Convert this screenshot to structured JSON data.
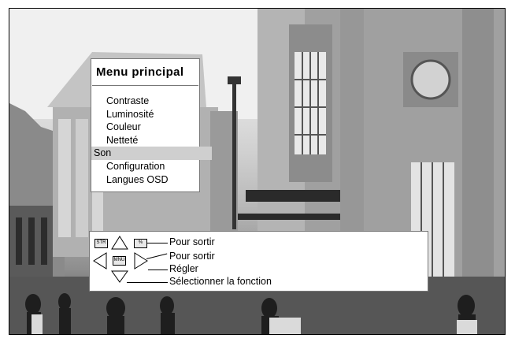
{
  "menu": {
    "title": "Menu principal",
    "items": [
      {
        "label": "Contraste",
        "selected": false
      },
      {
        "label": "Luminosité",
        "selected": false
      },
      {
        "label": "Couleur",
        "selected": false
      },
      {
        "label": "Netteté",
        "selected": false
      },
      {
        "label": "Son",
        "selected": true
      },
      {
        "label": "Configuration",
        "selected": false
      },
      {
        "label": "Langues OSD",
        "selected": false
      }
    ]
  },
  "help": {
    "key_str": "STR",
    "key_sym": "%",
    "key_mnu": "MNU",
    "lines": [
      "Pour sortir",
      "Pour sortir",
      "Régler",
      "Sélectionner la fonction"
    ]
  }
}
